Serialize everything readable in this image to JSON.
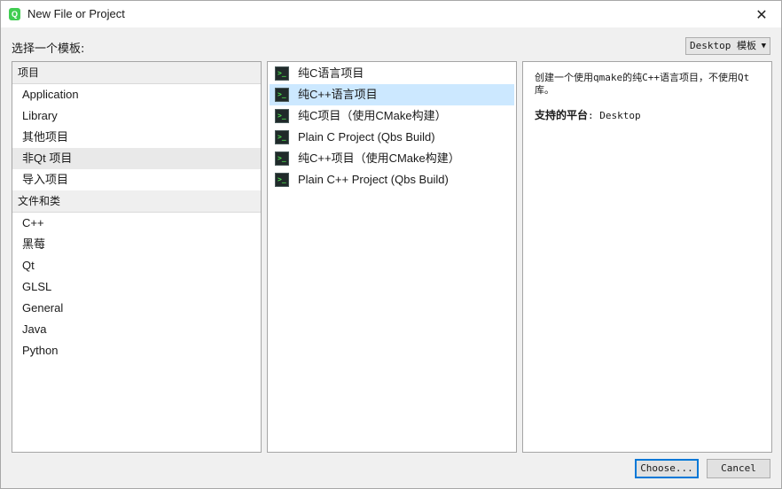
{
  "window": {
    "title": "New File or Project",
    "app_icon": "Q",
    "close_glyph": "✕"
  },
  "header": {
    "choose_template_label": "选择一个模板:",
    "filter": {
      "value": "Desktop 模板",
      "arrow": "▼"
    }
  },
  "categories": {
    "projects_header": "项目",
    "projects": [
      "Application",
      "Library",
      "其他项目",
      "非Qt 项目",
      "导入项目"
    ],
    "selected_project_index": 3,
    "files_header": "文件和类",
    "files": [
      "C++",
      "黑莓",
      "Qt",
      "GLSL",
      "General",
      "Java",
      "Python"
    ]
  },
  "templates": {
    "items": [
      "纯C语言项目",
      "纯C++语言项目",
      "纯C项目（使用CMake构建）",
      "Plain C Project (Qbs Build)",
      "纯C++项目（使用CMake构建）",
      "Plain C++ Project (Qbs Build)"
    ],
    "selected_index": 1,
    "icon": "terminal-icon",
    "icon_glyph": ">_"
  },
  "description": {
    "text": "创建一个使用qmake的纯C++语言项目，不使用Qt库。",
    "platforms_label": "支持的平台",
    "platforms_value": ": Desktop"
  },
  "buttons": {
    "choose": "Choose...",
    "cancel": "Cancel"
  },
  "colors": {
    "selection": "#cce8ff",
    "default_button_border": "#0078d7",
    "qt_green": "#41cd52"
  }
}
